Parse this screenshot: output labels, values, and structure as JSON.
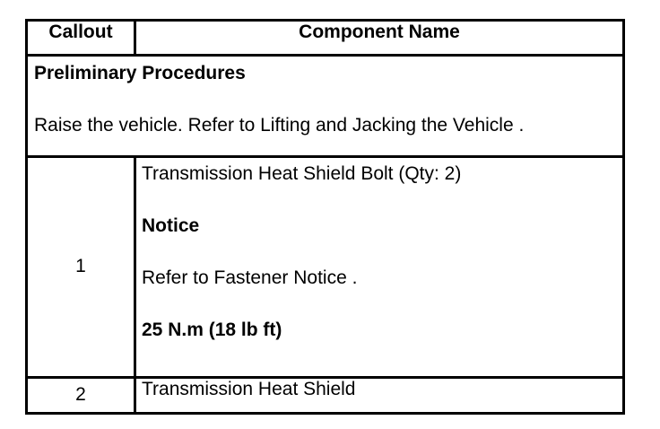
{
  "header": {
    "callout": "Callout",
    "component_name": "Component Name"
  },
  "preliminary": {
    "title": "Preliminary Procedures",
    "text": "Raise the vehicle. Refer to Lifting and Jacking the Vehicle ."
  },
  "rows": [
    {
      "callout": "1",
      "name": "Transmission Heat Shield Bolt (Qty: 2)",
      "notice_label": "Notice",
      "notice_text": "Refer to Fastener Notice .",
      "torque": "25 N.m (18 lb ft)"
    },
    {
      "callout": "2",
      "name": "Transmission Heat Shield"
    }
  ]
}
